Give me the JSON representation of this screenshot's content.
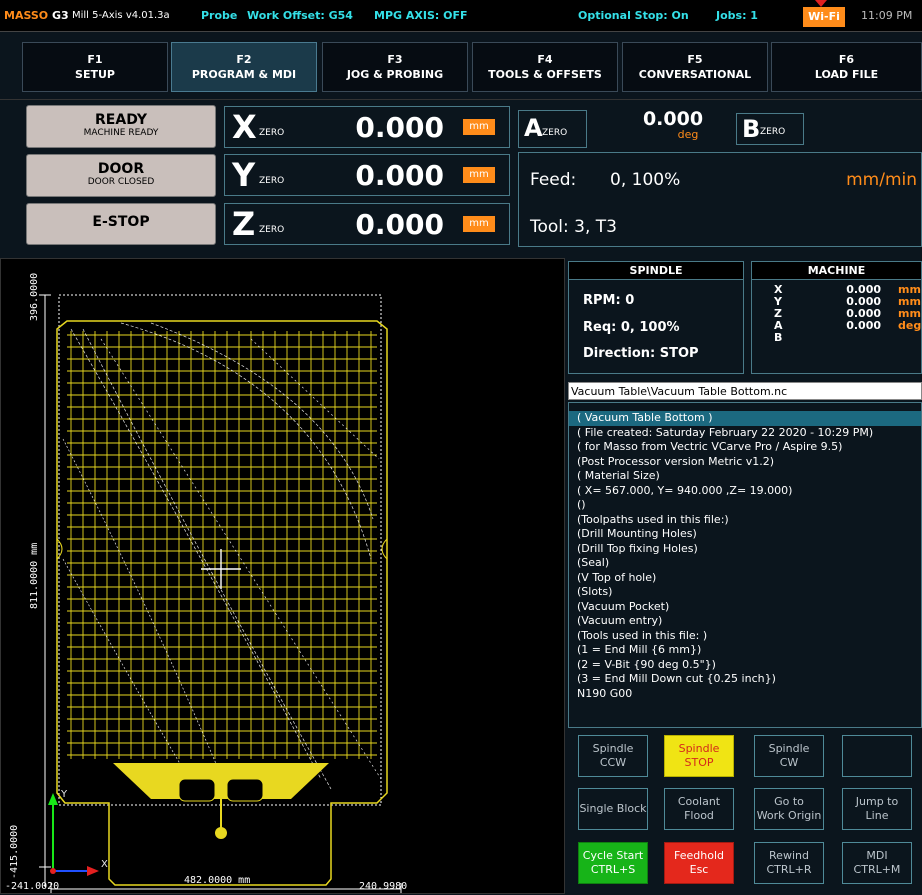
{
  "topbar": {
    "brand": "MASSO",
    "model": "G3",
    "version": "Mill 5-Axis v4.01.3a",
    "probe": "Probe",
    "work_offset": "Work Offset: G54",
    "mpg": "MPG AXIS: OFF",
    "optional_stop": "Optional Stop: On",
    "jobs": "Jobs: 1",
    "wifi": "Wi-Fi",
    "clock": "11:09 PM"
  },
  "tabs": [
    {
      "key": "F1",
      "label": "SETUP"
    },
    {
      "key": "F2",
      "label": "PROGRAM & MDI"
    },
    {
      "key": "F3",
      "label": "JOG & PROBING"
    },
    {
      "key": "F4",
      "label": "TOOLS & OFFSETS"
    },
    {
      "key": "F5",
      "label": "CONVERSATIONAL"
    },
    {
      "key": "F6",
      "label": "LOAD FILE"
    }
  ],
  "status": {
    "ready": {
      "title": "READY",
      "sub": "MACHINE READY"
    },
    "door": {
      "title": "DOOR",
      "sub": "DOOR CLOSED"
    },
    "estop": {
      "title": "E-STOP"
    }
  },
  "axes": {
    "x": {
      "letter": "X",
      "zero": "ZERO",
      "value": "0.000",
      "unit": "mm"
    },
    "y": {
      "letter": "Y",
      "zero": "ZERO",
      "value": "0.000",
      "unit": "mm"
    },
    "z": {
      "letter": "Z",
      "zero": "ZERO",
      "value": "0.000",
      "unit": "mm"
    },
    "a": {
      "letter": "A",
      "zero": "ZERO",
      "value": "0.000",
      "unit": "deg"
    },
    "b": {
      "letter": "B",
      "zero": "ZERO"
    }
  },
  "feed": {
    "label": "Feed:",
    "value": "0, 100%",
    "unit": "mm/min"
  },
  "tool": {
    "label": "Tool: 3, T3"
  },
  "plot": {
    "y_max": "396.0000",
    "y_mid": "811.0000 mm",
    "y_min": "-415.0000",
    "x_min": "-241.0020",
    "x_mid": "482.0000 mm",
    "x_max": "240.9980",
    "axis_x": "X",
    "axis_y": "Y"
  },
  "spindle": {
    "title": "SPINDLE",
    "rpm": "RPM: 0",
    "req": "Req: 0, 100%",
    "direction": "Direction: STOP"
  },
  "machine": {
    "title": "MACHINE",
    "rows": [
      {
        "axis": "X",
        "value": "0.000",
        "unit": "mm"
      },
      {
        "axis": "Y",
        "value": "0.000",
        "unit": "mm"
      },
      {
        "axis": "Z",
        "value": "0.000",
        "unit": "mm"
      },
      {
        "axis": "A",
        "value": "0.000",
        "unit": "deg"
      },
      {
        "axis": "B",
        "value": "",
        "unit": ""
      }
    ]
  },
  "file": {
    "title": "Vacuum Table\\Vacuum Table Bottom.nc",
    "lines": [
      "( Vacuum Table Bottom )",
      "( File created: Saturday February 22 2020 - 10:29 PM)",
      "( for Masso from Vectric VCarve Pro / Aspire 9.5)",
      "(Post Processor version Metric v1.2)",
      "( Material Size)",
      "( X= 567.000, Y= 940.000 ,Z= 19.000)",
      "()",
      "(Toolpaths used in this file:)",
      "(Drill Mounting Holes)",
      "(Drill Top fixing Holes)",
      "(Seal)",
      "(V Top of hole)",
      "(Slots)",
      "(Vacuum Pocket)",
      "(Vacuum entry)",
      "(Tools used in this file: )",
      "(1 = End Mill {6 mm})",
      "(2 = V-Bit {90 deg 0.5\"})",
      "(3 = End Mill Down cut {0.25 inch})",
      "N190 G00"
    ]
  },
  "buttons": {
    "spindle_ccw": [
      "Spindle",
      "CCW"
    ],
    "spindle_stop": [
      "Spindle",
      "STOP"
    ],
    "spindle_cw": [
      "Spindle",
      "CW"
    ],
    "single_block": [
      "Single Block"
    ],
    "coolant_flood": [
      "Coolant",
      "Flood"
    ],
    "goto_origin": [
      "Go to",
      "Work Origin"
    ],
    "jump_line": [
      "Jump to",
      "Line"
    ],
    "cycle_start": [
      "Cycle Start",
      "CTRL+S"
    ],
    "feedhold": [
      "Feedhold",
      "Esc"
    ],
    "rewind": [
      "Rewind",
      "CTRL+R"
    ],
    "mdi": [
      "MDI",
      "CTRL+M"
    ]
  },
  "colors": {
    "accent": "#ff8c1a",
    "cyan": "#34e0e8",
    "toolpath": "#e8d820",
    "panel_border": "#4a7a88",
    "cycle_start": "#17b418",
    "feedhold": "#e4281c",
    "spindle_stop": "#f0e414"
  }
}
